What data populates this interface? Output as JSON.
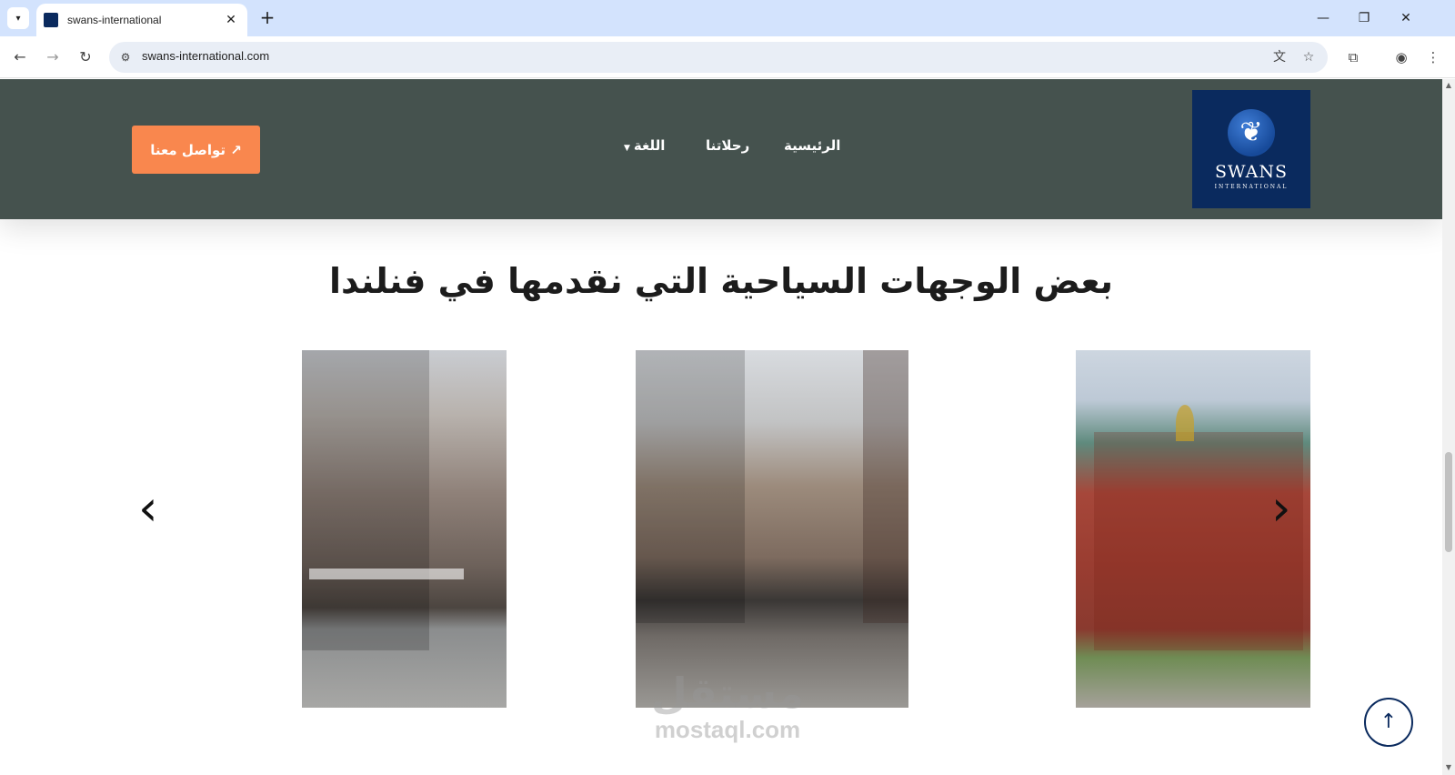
{
  "browser": {
    "tab_title": "swans-international",
    "url": "swans-international.com",
    "new_tab_label": "+",
    "close_tab_label": "✕"
  },
  "header": {
    "logo_text": "SWANS",
    "logo_subtext": "INTERNATIONAL",
    "nav": [
      {
        "label": "الرئيسية"
      },
      {
        "label": "رحلاتنا"
      },
      {
        "label": "اللغة"
      }
    ],
    "cta_label": "تواصل معنا ↗"
  },
  "section": {
    "title": "بعض الوجهات السياحية التي نقدمها في فنلندا"
  },
  "carousel": {
    "prev_label": "‹",
    "next_label": "›"
  },
  "watermark": {
    "arabic": "مستقل",
    "english": "mostaql.com"
  },
  "colors": {
    "header_bg": "#45524e",
    "cta_bg": "#f9874e",
    "logo_bg": "#0a2a5e",
    "tabstrip_bg": "#d3e3fd"
  }
}
